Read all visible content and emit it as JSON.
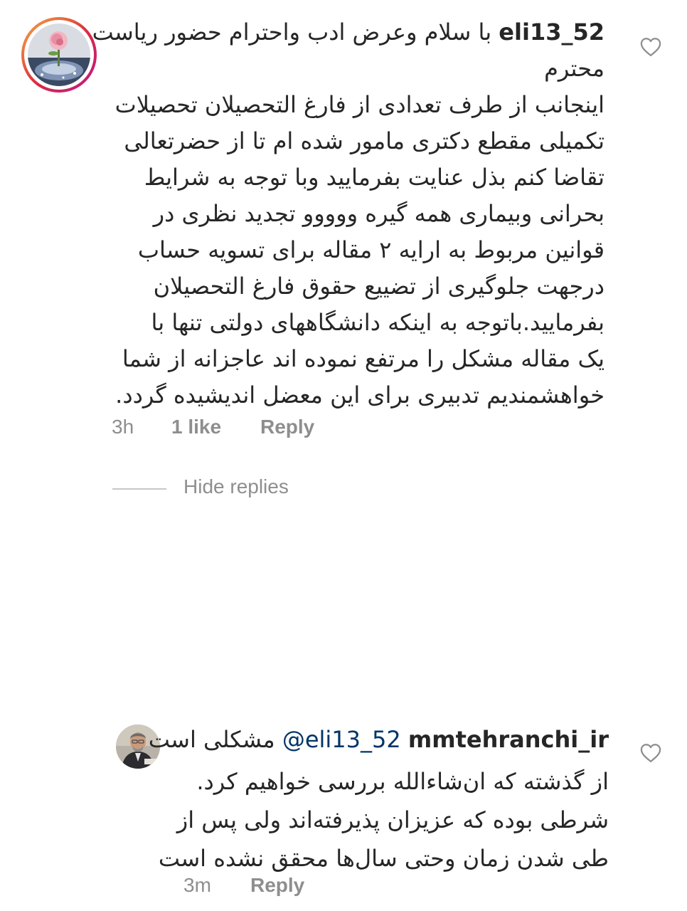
{
  "comment": {
    "username": "eli13_52",
    "first_line_text": "با سلام وعرض ادب واحترام حضور ریاست",
    "lines": [
      "محترم",
      "اینجانب از طرف تعدادی از فارغ التحصیلان  تحصیلات",
      "تکمیلی مقطع دکتری مامور شده ام تا از حضرتعالی",
      "تقاضا کنم بذل عنایت بفرمایید وبا توجه به شرایط",
      "بحرانی  وبیماری همه گیره ووووو تجدید نظری در",
      "قوانین مربوط به ارایه ۲ مقاله برای تسویه حساب",
      "درجهت جلوگیری از تضییع حقوق فارغ التحصیلان",
      "بفرمایید.باتوجه به اینکه دانشگاههای دولتی تنها با",
      "یک مقاله مشکل را مرتفع نموده اند عاجزانه از شما",
      "خواهشمندیم تدبیری برای این معضل اندیشیده گردد."
    ],
    "time": "3h",
    "likes": "1 like",
    "reply_label": "Reply"
  },
  "hide_replies_label": "Hide replies",
  "reply": {
    "username": "mmtehranchi_ir",
    "mention": "@eli13_52",
    "first_line_text": "مشکلی است",
    "lines": [
      "از گذشته که ان‌شاءالله  بررسی خواهیم کرد.",
      "شرطی بوده که عزیزان پذیرفته‌اند ولی پس از",
      "طی شدن زمان وحتی سال‌ها محقق نشده است"
    ],
    "time": "3m",
    "reply_label": "Reply"
  },
  "icons": {
    "like": "heart-outline-icon"
  },
  "colors": {
    "text": "#262626",
    "meta": "#8e8e8e",
    "mention": "#003569",
    "story_ring_start": "#f9a64a",
    "story_ring_end": "#bc1888"
  }
}
